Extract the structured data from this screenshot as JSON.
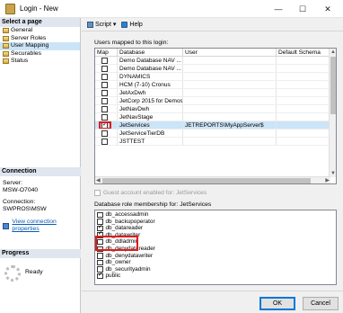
{
  "window": {
    "title": "Login - New",
    "minimize": "—",
    "maximize": "☐",
    "close": "✕"
  },
  "left": {
    "select_page_title": "Select a page",
    "pages": [
      "General",
      "Server Roles",
      "User Mapping",
      "Securables",
      "Status"
    ],
    "selected_page": "User Mapping",
    "connection_title": "Connection",
    "server_label": "Server:",
    "server_value": "MSW-O7040",
    "connection_label": "Connection:",
    "connection_value": "SWPROS\\MSW",
    "view_props_link": "View connection properties",
    "progress_title": "Progress",
    "progress_status": "Ready"
  },
  "toolbar": {
    "script_label": "Script",
    "script_arrow": "▾",
    "help_label": "Help"
  },
  "users_mapped": {
    "label": "Users mapped to this login:",
    "columns": [
      "Map",
      "Database",
      "User",
      "Default Schema"
    ],
    "rows": [
      {
        "checked": false,
        "database": "Demo Database NAV ...",
        "user": "",
        "schema": ""
      },
      {
        "checked": false,
        "database": "Demo Database NAV ...",
        "user": "",
        "schema": ""
      },
      {
        "checked": false,
        "database": "DYNAMICS",
        "user": "",
        "schema": ""
      },
      {
        "checked": false,
        "database": "HCM (7-10) Cronus",
        "user": "",
        "schema": ""
      },
      {
        "checked": false,
        "database": "JetAxDwh",
        "user": "",
        "schema": ""
      },
      {
        "checked": false,
        "database": "JetCorp 2015 for Demos",
        "user": "",
        "schema": ""
      },
      {
        "checked": false,
        "database": "JetNavDwh",
        "user": "",
        "schema": ""
      },
      {
        "checked": false,
        "database": "JetNavStage",
        "user": "",
        "schema": ""
      },
      {
        "checked": true,
        "database": "JetServices",
        "user": "JETREPORTS\\MyAppServer$",
        "schema": ""
      },
      {
        "checked": false,
        "database": "JetServiceTierDB",
        "user": "",
        "schema": ""
      },
      {
        "checked": false,
        "database": "JSTTEST",
        "user": "",
        "schema": ""
      }
    ],
    "selected_row": 8
  },
  "guest": {
    "label": "Guest account enabled for: JetServices"
  },
  "roles": {
    "label": "Database role membership for: JetServices",
    "items": [
      {
        "name": "db_accessadmin",
        "checked": false
      },
      {
        "name": "db_backupoperator",
        "checked": false
      },
      {
        "name": "db_datareader",
        "checked": true
      },
      {
        "name": "db_datawriter",
        "checked": true
      },
      {
        "name": "db_ddladmin",
        "checked": false
      },
      {
        "name": "db_denydatareader",
        "checked": false
      },
      {
        "name": "db_denydatawriter",
        "checked": false
      },
      {
        "name": "db_owner",
        "checked": false
      },
      {
        "name": "db_securityadmin",
        "checked": false
      },
      {
        "name": "public",
        "checked": true
      }
    ]
  },
  "buttons": {
    "ok": "OK",
    "cancel": "Cancel"
  },
  "colors": {
    "highlight_red": "#e01b1b",
    "selection_blue": "#cce4f7",
    "link_blue": "#0a5bb5"
  }
}
